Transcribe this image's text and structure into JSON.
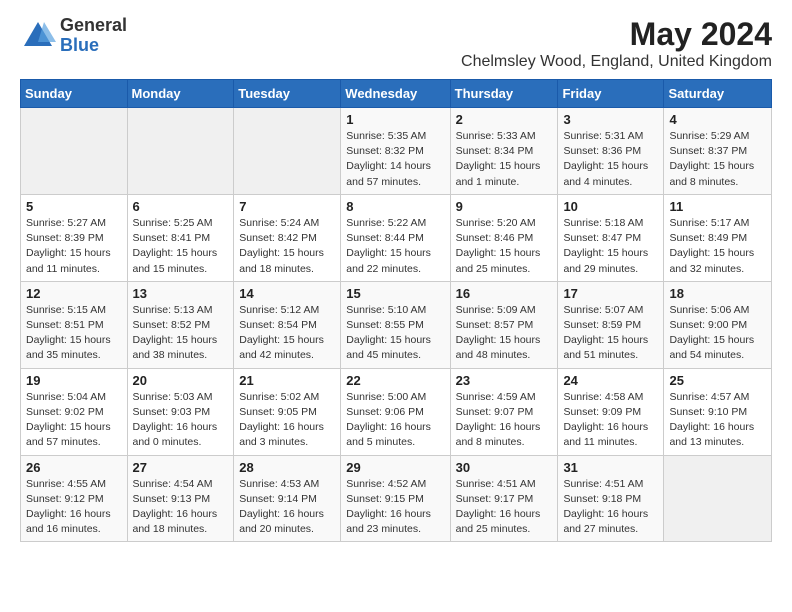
{
  "logo": {
    "general": "General",
    "blue": "Blue"
  },
  "title": "May 2024",
  "subtitle": "Chelmsley Wood, England, United Kingdom",
  "days_of_week": [
    "Sunday",
    "Monday",
    "Tuesday",
    "Wednesday",
    "Thursday",
    "Friday",
    "Saturday"
  ],
  "weeks": [
    [
      {
        "day": "",
        "info": ""
      },
      {
        "day": "",
        "info": ""
      },
      {
        "day": "",
        "info": ""
      },
      {
        "day": "1",
        "info": "Sunrise: 5:35 AM\nSunset: 8:32 PM\nDaylight: 14 hours\nand 57 minutes."
      },
      {
        "day": "2",
        "info": "Sunrise: 5:33 AM\nSunset: 8:34 PM\nDaylight: 15 hours\nand 1 minute."
      },
      {
        "day": "3",
        "info": "Sunrise: 5:31 AM\nSunset: 8:36 PM\nDaylight: 15 hours\nand 4 minutes."
      },
      {
        "day": "4",
        "info": "Sunrise: 5:29 AM\nSunset: 8:37 PM\nDaylight: 15 hours\nand 8 minutes."
      }
    ],
    [
      {
        "day": "5",
        "info": "Sunrise: 5:27 AM\nSunset: 8:39 PM\nDaylight: 15 hours\nand 11 minutes."
      },
      {
        "day": "6",
        "info": "Sunrise: 5:25 AM\nSunset: 8:41 PM\nDaylight: 15 hours\nand 15 minutes."
      },
      {
        "day": "7",
        "info": "Sunrise: 5:24 AM\nSunset: 8:42 PM\nDaylight: 15 hours\nand 18 minutes."
      },
      {
        "day": "8",
        "info": "Sunrise: 5:22 AM\nSunset: 8:44 PM\nDaylight: 15 hours\nand 22 minutes."
      },
      {
        "day": "9",
        "info": "Sunrise: 5:20 AM\nSunset: 8:46 PM\nDaylight: 15 hours\nand 25 minutes."
      },
      {
        "day": "10",
        "info": "Sunrise: 5:18 AM\nSunset: 8:47 PM\nDaylight: 15 hours\nand 29 minutes."
      },
      {
        "day": "11",
        "info": "Sunrise: 5:17 AM\nSunset: 8:49 PM\nDaylight: 15 hours\nand 32 minutes."
      }
    ],
    [
      {
        "day": "12",
        "info": "Sunrise: 5:15 AM\nSunset: 8:51 PM\nDaylight: 15 hours\nand 35 minutes."
      },
      {
        "day": "13",
        "info": "Sunrise: 5:13 AM\nSunset: 8:52 PM\nDaylight: 15 hours\nand 38 minutes."
      },
      {
        "day": "14",
        "info": "Sunrise: 5:12 AM\nSunset: 8:54 PM\nDaylight: 15 hours\nand 42 minutes."
      },
      {
        "day": "15",
        "info": "Sunrise: 5:10 AM\nSunset: 8:55 PM\nDaylight: 15 hours\nand 45 minutes."
      },
      {
        "day": "16",
        "info": "Sunrise: 5:09 AM\nSunset: 8:57 PM\nDaylight: 15 hours\nand 48 minutes."
      },
      {
        "day": "17",
        "info": "Sunrise: 5:07 AM\nSunset: 8:59 PM\nDaylight: 15 hours\nand 51 minutes."
      },
      {
        "day": "18",
        "info": "Sunrise: 5:06 AM\nSunset: 9:00 PM\nDaylight: 15 hours\nand 54 minutes."
      }
    ],
    [
      {
        "day": "19",
        "info": "Sunrise: 5:04 AM\nSunset: 9:02 PM\nDaylight: 15 hours\nand 57 minutes."
      },
      {
        "day": "20",
        "info": "Sunrise: 5:03 AM\nSunset: 9:03 PM\nDaylight: 16 hours\nand 0 minutes."
      },
      {
        "day": "21",
        "info": "Sunrise: 5:02 AM\nSunset: 9:05 PM\nDaylight: 16 hours\nand 3 minutes."
      },
      {
        "day": "22",
        "info": "Sunrise: 5:00 AM\nSunset: 9:06 PM\nDaylight: 16 hours\nand 5 minutes."
      },
      {
        "day": "23",
        "info": "Sunrise: 4:59 AM\nSunset: 9:07 PM\nDaylight: 16 hours\nand 8 minutes."
      },
      {
        "day": "24",
        "info": "Sunrise: 4:58 AM\nSunset: 9:09 PM\nDaylight: 16 hours\nand 11 minutes."
      },
      {
        "day": "25",
        "info": "Sunrise: 4:57 AM\nSunset: 9:10 PM\nDaylight: 16 hours\nand 13 minutes."
      }
    ],
    [
      {
        "day": "26",
        "info": "Sunrise: 4:55 AM\nSunset: 9:12 PM\nDaylight: 16 hours\nand 16 minutes."
      },
      {
        "day": "27",
        "info": "Sunrise: 4:54 AM\nSunset: 9:13 PM\nDaylight: 16 hours\nand 18 minutes."
      },
      {
        "day": "28",
        "info": "Sunrise: 4:53 AM\nSunset: 9:14 PM\nDaylight: 16 hours\nand 20 minutes."
      },
      {
        "day": "29",
        "info": "Sunrise: 4:52 AM\nSunset: 9:15 PM\nDaylight: 16 hours\nand 23 minutes."
      },
      {
        "day": "30",
        "info": "Sunrise: 4:51 AM\nSunset: 9:17 PM\nDaylight: 16 hours\nand 25 minutes."
      },
      {
        "day": "31",
        "info": "Sunrise: 4:51 AM\nSunset: 9:18 PM\nDaylight: 16 hours\nand 27 minutes."
      },
      {
        "day": "",
        "info": ""
      }
    ]
  ]
}
